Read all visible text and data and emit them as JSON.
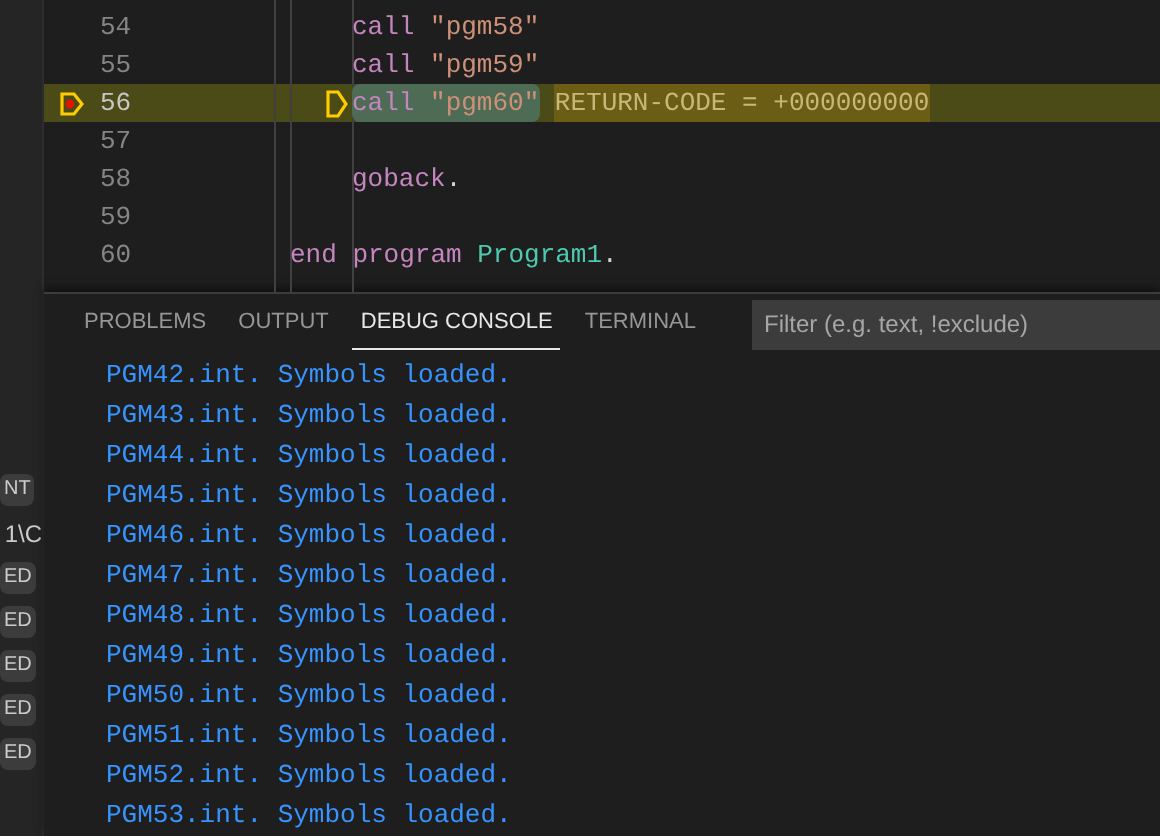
{
  "sidebar": {
    "badges": [
      {
        "text": "NT",
        "kind": "badge"
      },
      {
        "text": "1\\C",
        "kind": "text"
      },
      {
        "text": "ED",
        "kind": "badge"
      },
      {
        "text": "ED",
        "kind": "badge"
      },
      {
        "text": "ED",
        "kind": "badge"
      },
      {
        "text": "ED",
        "kind": "badge"
      },
      {
        "text": "ED",
        "kind": "badge"
      }
    ]
  },
  "editor": {
    "lines": [
      {
        "number": "54",
        "kind": "body",
        "breakpoint": false,
        "current": false,
        "tokens": [
          {
            "kind": "keyword",
            "text": "call"
          },
          {
            "kind": "string",
            "text": "\"pgm58\""
          }
        ]
      },
      {
        "number": "55",
        "kind": "body",
        "breakpoint": false,
        "current": false,
        "tokens": [
          {
            "kind": "keyword",
            "text": "call"
          },
          {
            "kind": "string",
            "text": "\"pgm59\""
          }
        ]
      },
      {
        "number": "56",
        "kind": "body",
        "breakpoint": true,
        "current": true,
        "tokens": [
          {
            "kind": "keyword",
            "text": "call"
          },
          {
            "kind": "string",
            "text": "\"pgm60\""
          }
        ],
        "inline_value": "RETURN-CODE = +000000000"
      },
      {
        "number": "57",
        "kind": "body",
        "breakpoint": false,
        "current": false
      },
      {
        "number": "58",
        "kind": "body",
        "breakpoint": false,
        "current": false,
        "tokens": [
          {
            "kind": "keyword",
            "text": "goback"
          },
          {
            "kind": "plain",
            "text": "."
          }
        ]
      },
      {
        "number": "59",
        "kind": "body",
        "breakpoint": false,
        "current": false
      },
      {
        "number": "60",
        "kind": "end",
        "breakpoint": false,
        "current": false,
        "tokens": [
          {
            "kind": "keyword",
            "text": "end"
          },
          {
            "kind": "keyword",
            "text": "program"
          },
          {
            "kind": "type",
            "text": "Program1"
          },
          {
            "kind": "plain",
            "text": "."
          }
        ]
      }
    ]
  },
  "panel": {
    "tabs": [
      {
        "label": "PROBLEMS",
        "selected": false
      },
      {
        "label": "OUTPUT",
        "selected": false
      },
      {
        "label": "DEBUG CONSOLE",
        "selected": true
      },
      {
        "label": "TERMINAL",
        "selected": false
      }
    ],
    "filter": {
      "placeholder": "Filter (e.g. text, !exclude)"
    },
    "console_lines": [
      "PGM42.int. Symbols loaded.",
      "PGM43.int. Symbols loaded.",
      "PGM44.int. Symbols loaded.",
      "PGM45.int. Symbols loaded.",
      "PGM46.int. Symbols loaded.",
      "PGM47.int. Symbols loaded.",
      "PGM48.int. Symbols loaded.",
      "PGM49.int. Symbols loaded.",
      "PGM50.int. Symbols loaded.",
      "PGM51.int. Symbols loaded.",
      "PGM52.int. Symbols loaded.",
      "PGM53.int. Symbols loaded."
    ]
  }
}
